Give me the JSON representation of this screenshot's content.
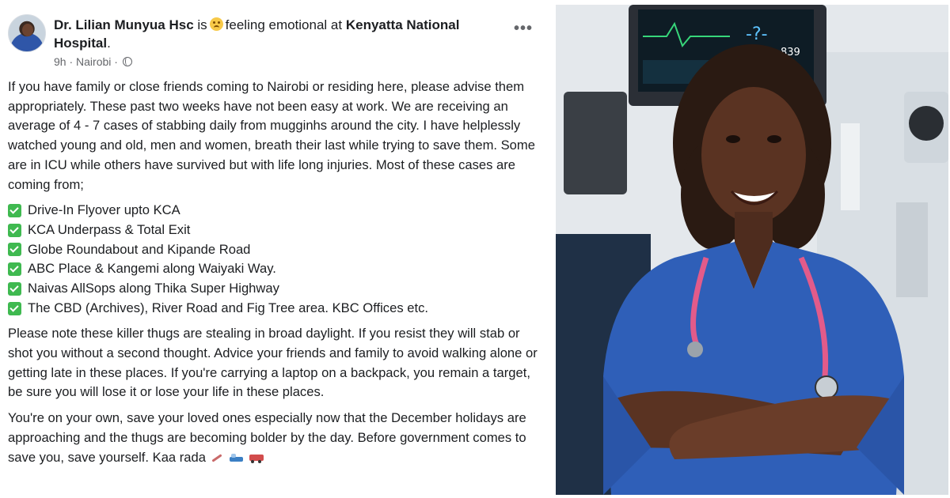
{
  "post": {
    "author": "Dr. Lilian Munyua Hsc",
    "feeling_prefix": "is",
    "feeling_text": "feeling emotional at",
    "location": "Kenyatta National Hospital",
    "location_suffix": ".",
    "time": "9h",
    "place": "Nairobi",
    "separator": "·",
    "more_label": "•••",
    "paragraph_1": "If you have family or close friends coming to Nairobi or residing here, please advise them appropriately. These past two weeks have not been easy at work. We are receiving an average of 4 - 7 cases of stabbing daily from mugginhs around the city. I have helplessly watched young and old, men and women, breath their last while trying to save them. Some are in ICU while others have survived but with life long injuries. Most of these cases are coming from;",
    "locations": [
      "Drive-In Flyover upto KCA",
      "KCA Underpass & Total Exit",
      "Globe Roundabout and Kipande Road",
      "ABC Place & Kangemi along Waiyaki Way.",
      "Naivas AllSops along Thika Super Highway",
      "The CBD (Archives), River Road and Fig Tree area. KBC Offices etc."
    ],
    "paragraph_2": "Please note these killer thugs are stealing in broad daylight. If you resist they will stab or shot you without a second thought. Advice your friends and family to avoid walking alone or getting late in these places. If you're carrying a laptop on a backpack, you remain a target, be sure you will lose it or lose your life in these places.",
    "paragraph_3": "You're on your own, save your loved ones especially now that the December holidays are approaching and the thugs are becoming bolder by the day. Before government comes to save you, save yourself. Kaa rada",
    "trailing_emojis": [
      "syringe-icon",
      "hospital-bed-icon",
      "ambulance-icon"
    ]
  },
  "photo": {
    "monitor_readings": [
      "-?-",
      "839"
    ],
    "colors": {
      "scrubs": "#2f5fb8",
      "stethoscope": "#e25b8a",
      "wall": "#e6eaee"
    }
  }
}
